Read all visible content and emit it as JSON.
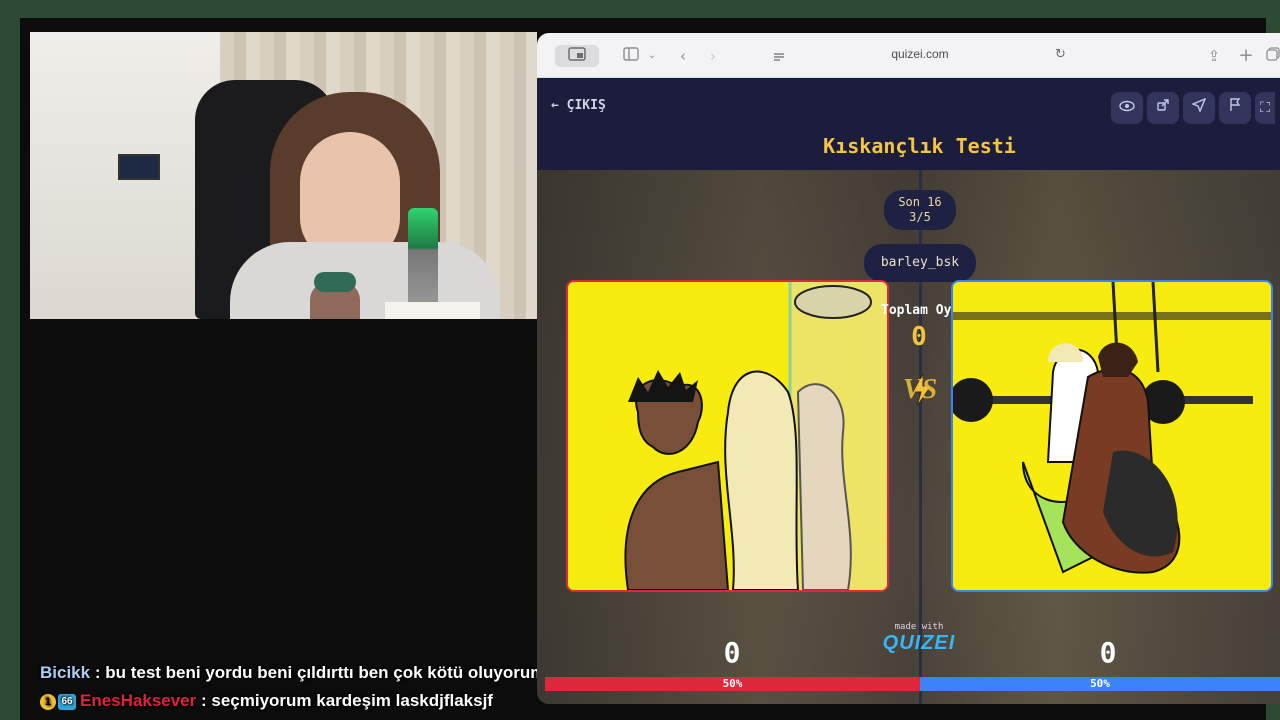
{
  "browser": {
    "url": "quizei.com"
  },
  "quiz": {
    "exit_label": "ÇIKIŞ",
    "title": "Kıskançlık Testi",
    "round_stage": "Son 16",
    "round_progress": "3/5",
    "username": "barley_bsk",
    "total_votes_label": "Toplam Oy",
    "total_votes_value": "0",
    "vs_label": "VS",
    "made_with": "made with",
    "brand": "QUIZEI",
    "left_score": "0",
    "right_score": "0",
    "left_percent_label": "50%",
    "right_percent_label": "50%",
    "left_percent": 50,
    "right_percent": 50,
    "colors": {
      "left": "#e0283c",
      "right": "#3b82f6",
      "accent": "#f2c43a",
      "header_bg": "#1c1d3c"
    }
  },
  "chat": {
    "messages": [
      {
        "user": "Bicikk",
        "text": ": bu test beni yordu beni çıldırttı ben çok kötü oluyorum"
      },
      {
        "user": "EnesHaksever",
        "text": ": seçmiyorum kardeşim laskdjflaksjf",
        "badges": [
          "1",
          "66"
        ]
      }
    ]
  },
  "icons": [
    "sidebar-icon",
    "back-icon",
    "forward-icon",
    "reader-icon",
    "reload-icon",
    "share-icon",
    "new-tab-icon",
    "eye-icon",
    "share-quiz-icon",
    "send-icon",
    "flag-icon",
    "fullscreen-icon",
    "bolt-icon"
  ]
}
